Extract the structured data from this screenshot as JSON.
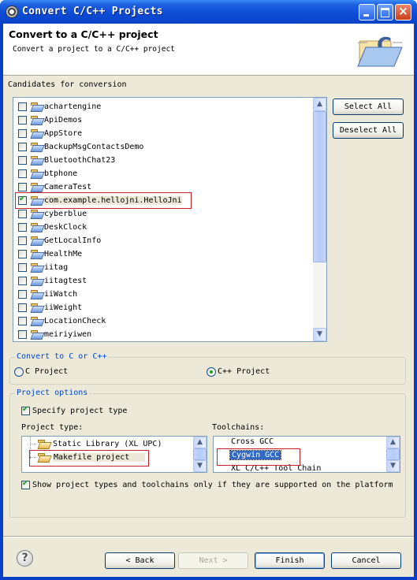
{
  "window": {
    "title": "Convert C/C++ Projects",
    "controls": {
      "minimize": "minimize",
      "maximize": "maximize",
      "close": "×"
    }
  },
  "header": {
    "title": "Convert to a C/C++ project",
    "description": "Convert a project to a C/C++ project",
    "icon": "folder-c-icon"
  },
  "candidates": {
    "label": "Candidates for conversion",
    "items": [
      {
        "label": "achartengine",
        "checked": false
      },
      {
        "label": "ApiDemos",
        "checked": false
      },
      {
        "label": "AppStore",
        "checked": false
      },
      {
        "label": "BackupMsgContactsDemo",
        "checked": false
      },
      {
        "label": "BluetoothChat23",
        "checked": false
      },
      {
        "label": "btphone",
        "checked": false
      },
      {
        "label": "CameraTest",
        "checked": false
      },
      {
        "label": "com.example.hellojni.HelloJni",
        "checked": true
      },
      {
        "label": "cyberblue",
        "checked": false
      },
      {
        "label": "DeskClock",
        "checked": false
      },
      {
        "label": "GetLocalInfo",
        "checked": false
      },
      {
        "label": "HealthMe",
        "checked": false
      },
      {
        "label": "iitag",
        "checked": false
      },
      {
        "label": "iitagtest",
        "checked": false
      },
      {
        "label": "iiWatch",
        "checked": false
      },
      {
        "label": "iiWeight",
        "checked": false
      },
      {
        "label": "LocationCheck",
        "checked": false
      },
      {
        "label": "meiriyiwen",
        "checked": false
      }
    ],
    "select_all": "Select All",
    "deselect_all": "Deselect All"
  },
  "convert_group": {
    "legend": "Convert to C or C++",
    "options": [
      {
        "label": "C Project",
        "selected": false
      },
      {
        "label": "C++ Project",
        "selected": true
      }
    ]
  },
  "project_options": {
    "legend": "Project options",
    "specify_type": {
      "label": "Specify project type",
      "checked": true
    },
    "project_type_label": "Project type:",
    "project_types": [
      {
        "label": "Static Library (XL UPC)",
        "selected": false
      },
      {
        "label": "Makefile project",
        "selected": true
      }
    ],
    "toolchains_label": "Toolchains:",
    "toolchains": [
      {
        "label": "Cross GCC",
        "selected": false
      },
      {
        "label": "Cygwin GCC",
        "selected": true
      },
      {
        "label": "XL C/C++ Tool Chain",
        "selected": false
      }
    ],
    "show_supported": {
      "label": "Show project types and toolchains only if they are supported on the platform",
      "checked": true
    }
  },
  "footer": {
    "help": "?",
    "back": "< Back",
    "next": "Next >",
    "finish": "Finish",
    "cancel": "Cancel"
  },
  "colors": {
    "titlebar": "#0a44c6",
    "group_legend": "#0046d5",
    "selection": "#316ac5",
    "highlight_annotation": "#c8202a"
  }
}
